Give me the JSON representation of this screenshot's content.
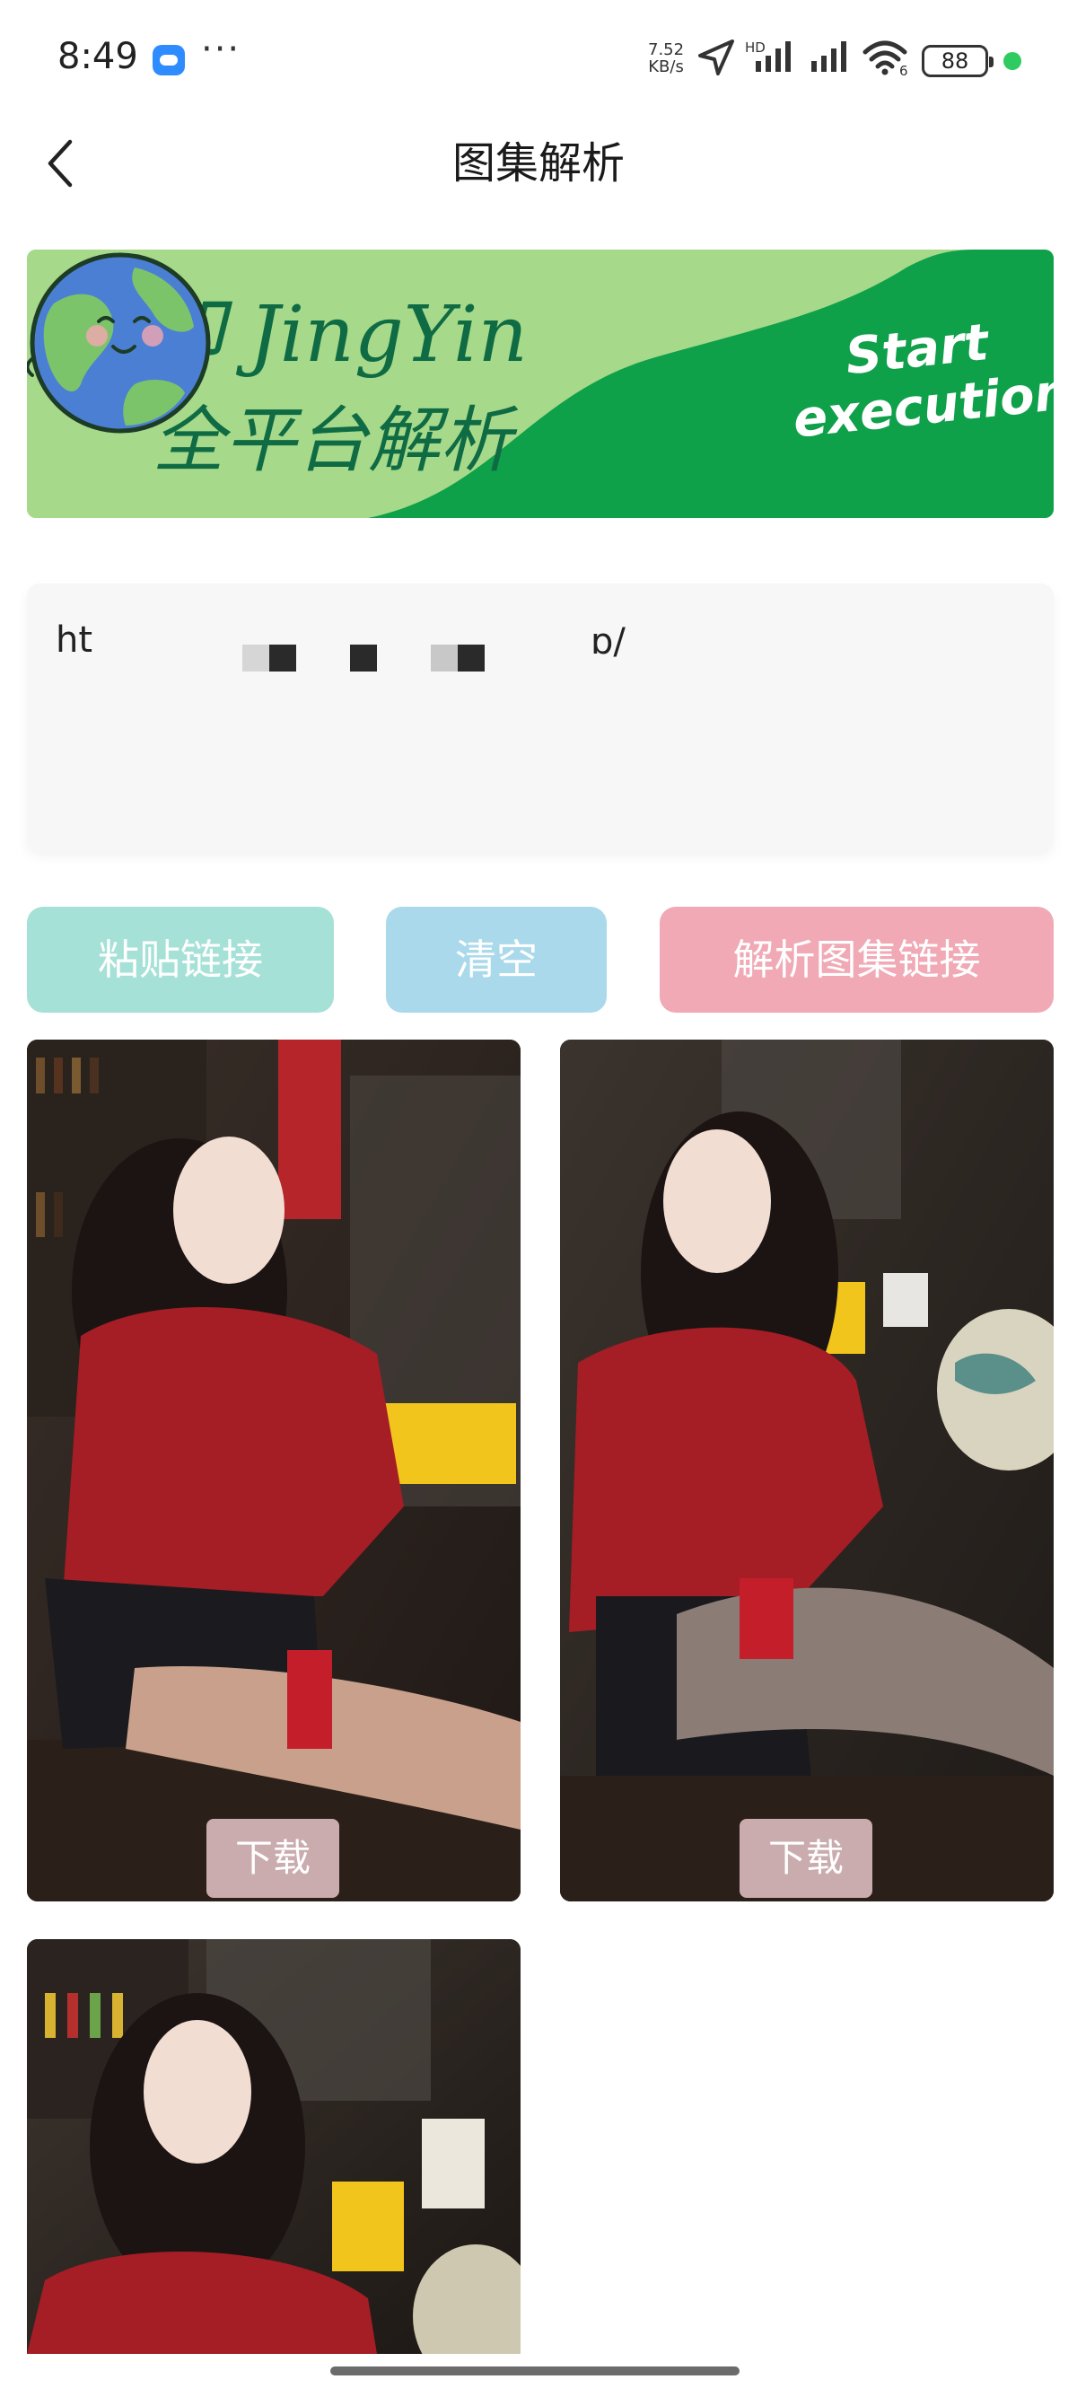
{
  "status_bar": {
    "time": "8:49",
    "more": "···",
    "net_speed_value": "7.52",
    "net_speed_unit": "KB/s",
    "signal_tag": "HD",
    "wifi_tag": "6",
    "battery": "88"
  },
  "header": {
    "title": "图集解析"
  },
  "banner": {
    "line1": "净印 JingYin",
    "line2": "全平台解析",
    "cta_line1": "Start",
    "cta_line2": "execution"
  },
  "link_input": {
    "value_start": "ht",
    "value_end": "ɒ/"
  },
  "buttons": {
    "paste": "粘贴链接",
    "clear": "清空",
    "parse": "解析图集链接"
  },
  "results": {
    "download_label": "下载",
    "image_count": 3
  },
  "colors": {
    "paste_button": "#a5e1d6",
    "clear_button": "#a9d9ea",
    "parse_button": "#f0a9b5",
    "banner_green": "#0fa04a",
    "banner_light": "#a6d98a"
  }
}
